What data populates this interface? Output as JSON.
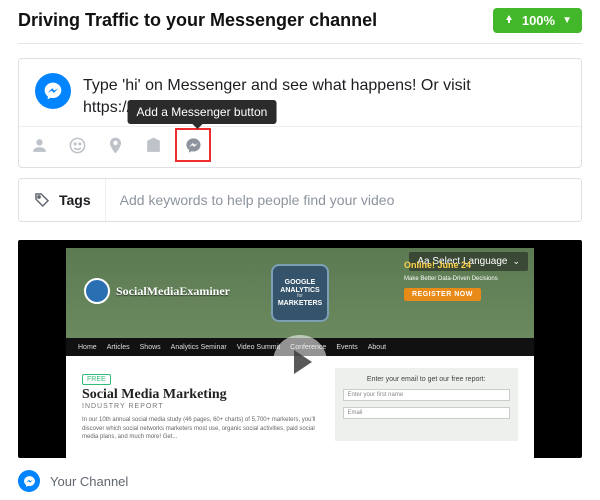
{
  "header": {
    "title": "Driving Traffic to your Messenger channel",
    "upload_progress": "100%"
  },
  "composer": {
    "instruction": "Type 'hi' on Messenger and see what happens! Or visit https://m.me/Y",
    "tooltip": "Add a Messenger button"
  },
  "tags": {
    "label": "Tags",
    "placeholder": "Add keywords to help people find your video"
  },
  "preview": {
    "language_selector": "Aa Select Language",
    "brand": "SocialMediaExaminer",
    "hero_badge": {
      "line1": "GOOGLE",
      "line2": "ANALYTICS",
      "line3": "MARKETERS"
    },
    "promo": {
      "headline": "Online! June 24",
      "sub": "Make Better Data-Driven Decisions",
      "cta": "REGISTER NOW"
    },
    "nav": [
      "Home",
      "Articles",
      "Shows",
      "Analytics Seminar",
      "Video Summit",
      "Conference",
      "Events",
      "About"
    ],
    "report": {
      "tag": "FREE",
      "title": "Social Media Marketing",
      "subtitle": "INDUSTRY REPORT",
      "desc": "In our 10th annual social media study (46 pages, 60+ charts) of 5,700+ marketers, you'll discover which social networks marketers most use, organic social activities, paid social media plans, and much more! Get..."
    },
    "optin": {
      "heading": "Enter your email to get our free report:",
      "field1": "Enter your first name",
      "field2": "Email"
    }
  },
  "footer": {
    "channel_name": "Your Channel"
  }
}
